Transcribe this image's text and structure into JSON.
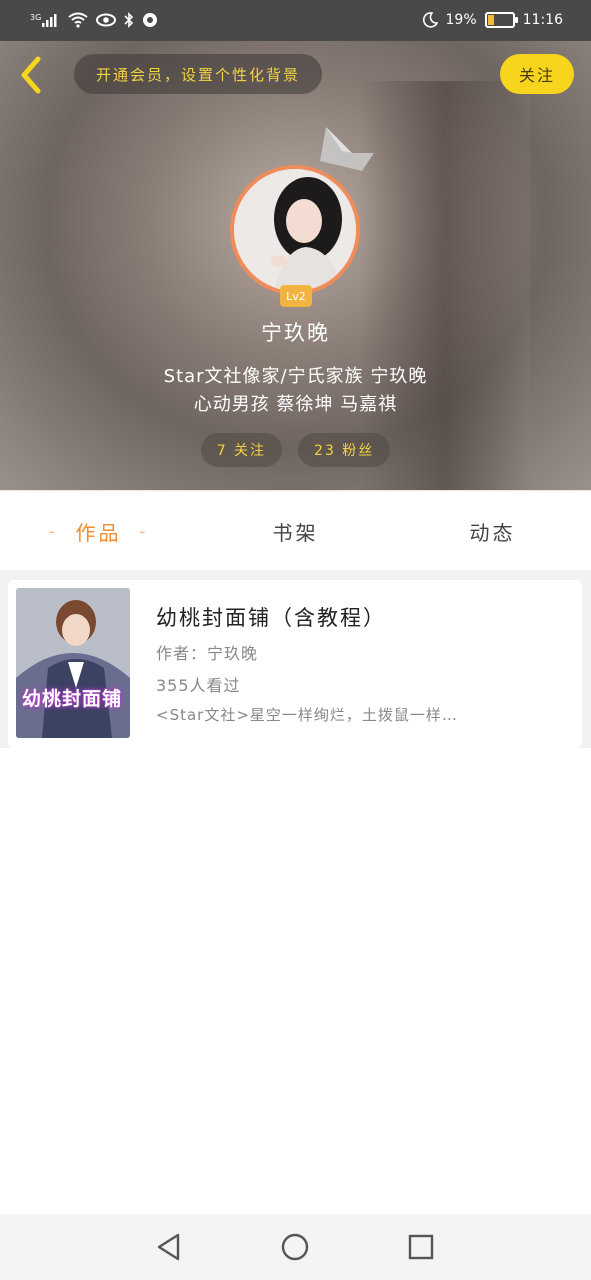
{
  "status_bar": {
    "network": "3G",
    "battery_percent": "19%",
    "time": "11:16"
  },
  "header": {
    "vip_text": "开通会员，设置个性化背景",
    "follow_label": "关注",
    "level_badge": "Lv2",
    "username": "宁玖晚",
    "bio_line1": "Star文社像家/宁氏家族 宁玖晚",
    "bio_line2": "心动男孩 蔡徐坤 马嘉祺",
    "following": "7 关注",
    "followers": "23 粉丝"
  },
  "tabs": [
    {
      "label": "作品",
      "active": true
    },
    {
      "label": "书架",
      "active": false
    },
    {
      "label": "动态",
      "active": false
    }
  ],
  "works": [
    {
      "cover_text": "幼桃封面铺",
      "title": "幼桃封面铺（含教程）",
      "author": "作者：宁玖晚",
      "views": "355人看过",
      "summary": "<Star文社>星空一样绚烂，土拨鼠一样…"
    }
  ],
  "colors": {
    "accent": "#f08c2e",
    "follow_bg": "#f7d51c",
    "vip_text": "#f2d343",
    "avatar_ring": "#f08c5a"
  }
}
